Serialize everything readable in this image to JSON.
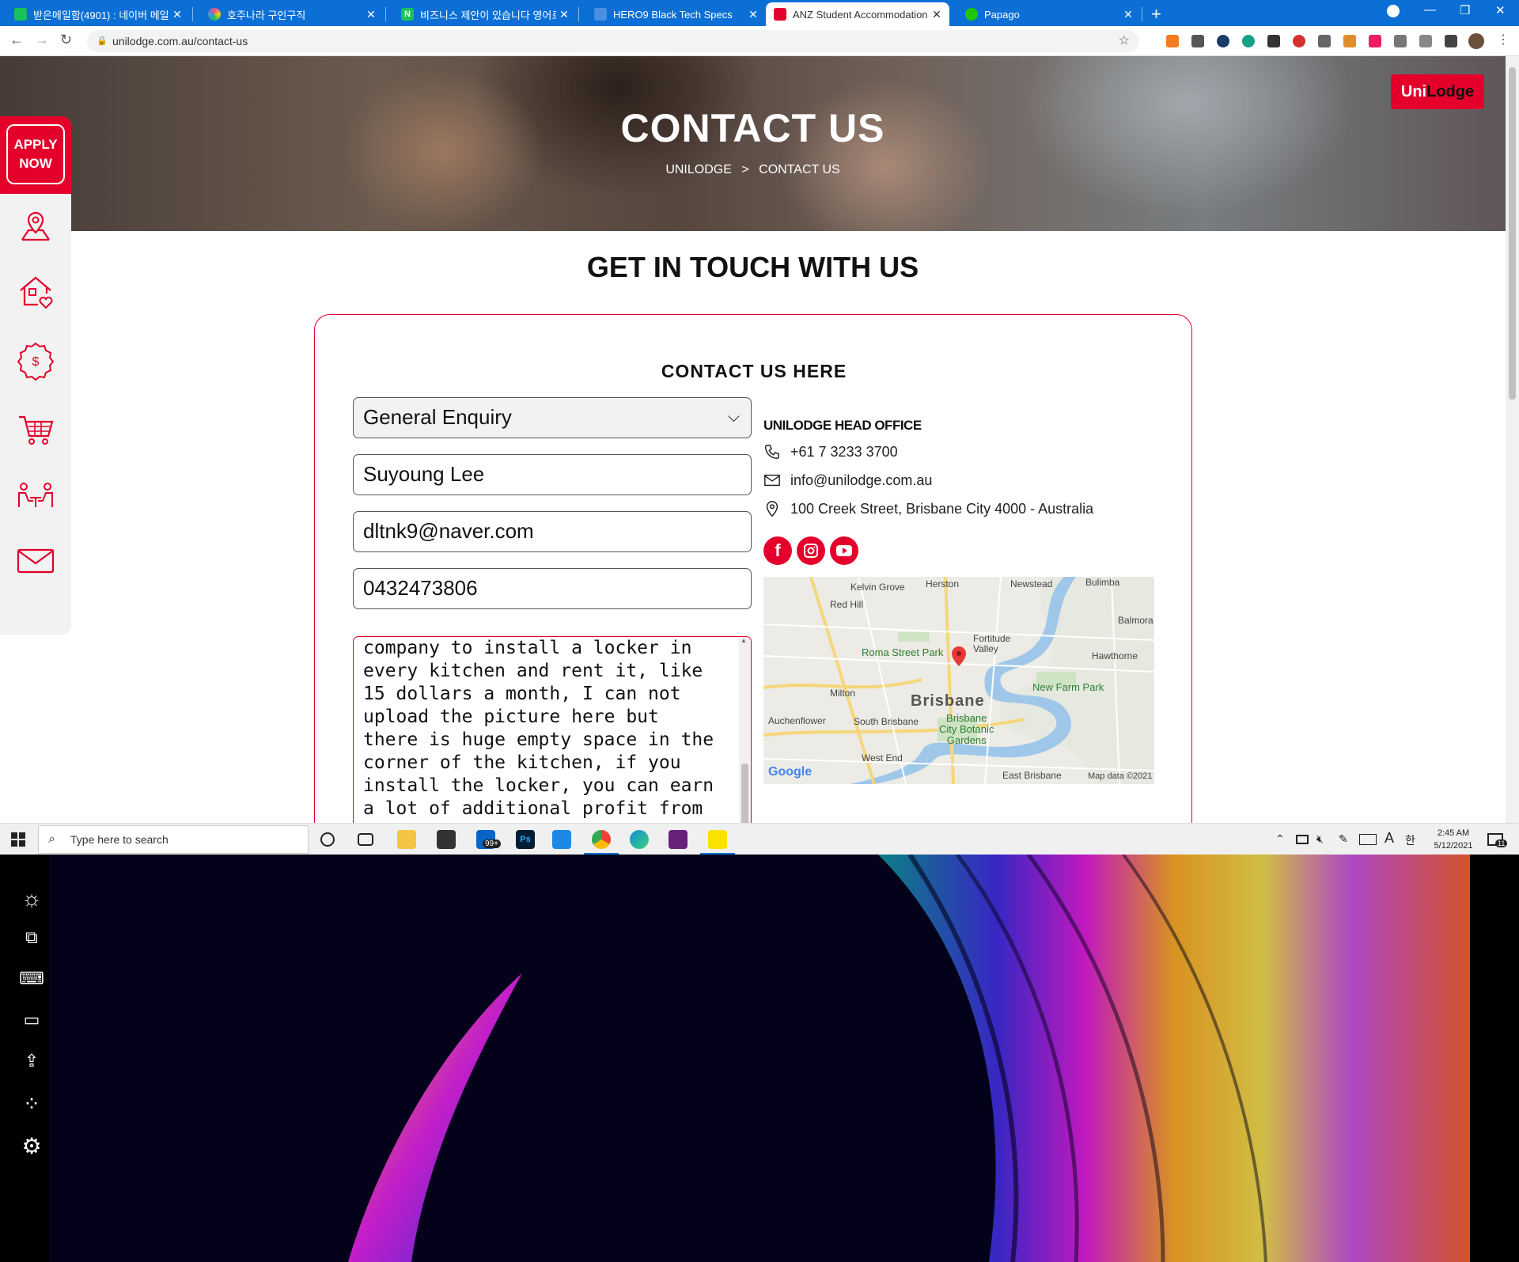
{
  "browser": {
    "tabs": [
      {
        "label": "받은메일함(4901) : 네이버 메일",
        "color": "#19c25a"
      },
      {
        "label": "호주나라 구인구직",
        "color": "#e94b8a"
      },
      {
        "label": "비즈니스 제안이 있습니다 영어로",
        "color": "#19c25a"
      },
      {
        "label": "HERO9 Black Tech Specs",
        "color": "#4a90e2"
      },
      {
        "label": "ANZ Student Accommodation | C",
        "color": "#e4002b"
      },
      {
        "label": "Papago",
        "color": "#1ec800"
      }
    ],
    "url": "unilodge.com.au/contact-us"
  },
  "hero": {
    "title": "CONTACT US",
    "crumb_home": "UNILODGE",
    "crumb_sep": ">",
    "crumb_current": "CONTACT US",
    "logo_uni": "Uni",
    "logo_lodge": "Lodge"
  },
  "rail": {
    "apply_line1": "APPLY",
    "apply_line2": "NOW",
    "icons": [
      "map-pin-icon",
      "house-heart-icon",
      "dollar-badge-icon",
      "cart-icon",
      "people-meeting-icon",
      "mail-icon"
    ]
  },
  "page": {
    "heading": "GET IN TOUCH WITH US",
    "card_title": "CONTACT US HERE"
  },
  "form": {
    "enquiry_type": "General Enquiry",
    "name": "Suyoung Lee",
    "email": "dltnk9@naver.com",
    "phone": "0432473806",
    "message": "company to install a locker in\nevery kitchen and rent it, like\n15 dollars a month, I can not\nupload the picture here but\nthere is huge empty space in the\ncorner of the kitchen, if you\ninstall the locker, you can earn\na lot of additional profit from"
  },
  "office": {
    "heading": "UNILODGE HEAD OFFICE",
    "phone": "+61 7 3233 3700",
    "email": "info@unilodge.com.au",
    "address": "100 Creek Street, Brisbane City 4000 - Australia"
  },
  "map": {
    "labels": {
      "kelvin_grove": "Kelvin Grove",
      "herston": "Herston",
      "newstead": "Newstead",
      "bulimba": "Bulimba",
      "red_hill": "Red Hill",
      "balmoral": "Balmora",
      "fortitude_valley": "Fortitude\nValley",
      "roma_street": "Roma Street Park",
      "hawthorne": "Hawthorne",
      "new_farm_park": "New Farm Park",
      "milton": "Milton",
      "brisbane": "Brisbane",
      "auchenflower": "Auchenflower",
      "south_brisbane": "South Brisbane",
      "botanic": "Brisbane\nCity Botanic\nGardens",
      "west_end": "West End",
      "east_brisbane": "East Brisbane"
    },
    "google": "Google",
    "attribution": "Map data ©2021"
  },
  "taskbar": {
    "search_placeholder": "Type here to search",
    "mail_badge": "99+",
    "time": "2:45 AM",
    "date": "5/12/2021",
    "notif_count": "11"
  },
  "colors": {
    "brand_red": "#e4002b",
    "chrome_blue": "#0b6fd6"
  }
}
